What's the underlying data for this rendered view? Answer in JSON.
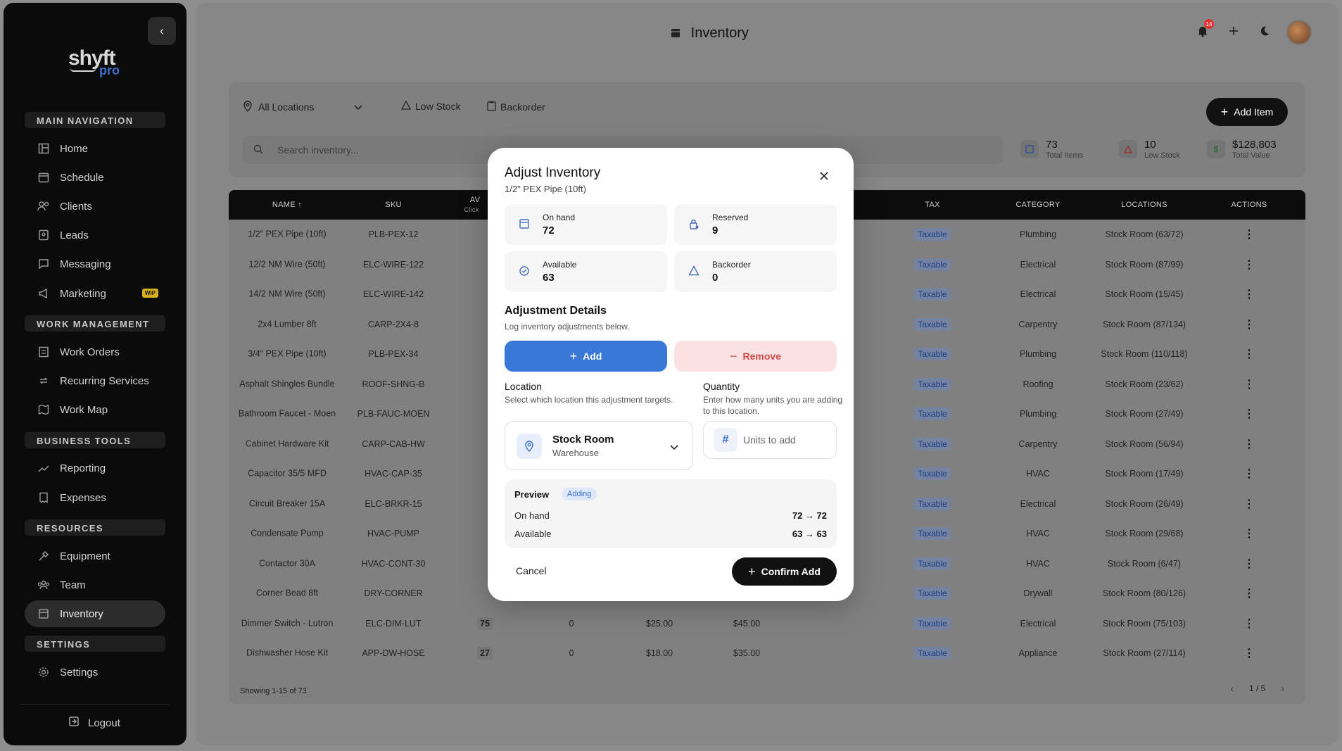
{
  "colors": {
    "accent": "#3a78d8",
    "danger": "#d04a4a",
    "dark": "#111111",
    "wip": "#d7b01c"
  },
  "sidebar": {
    "logo_text": "shyft",
    "logo_sub": "pro",
    "sections": {
      "main": "MAIN NAVIGATION",
      "work": "WORK MANAGEMENT",
      "business": "BUSINESS TOOLS",
      "resources": "RESOURCES",
      "settings": "SETTINGS"
    },
    "items": {
      "home": "Home",
      "schedule": "Schedule",
      "clients": "Clients",
      "leads": "Leads",
      "messaging": "Messaging",
      "marketing": "Marketing",
      "marketing_badge": "WIP",
      "work_orders": "Work Orders",
      "recurring": "Recurring Services",
      "work_map": "Work Map",
      "reporting": "Reporting",
      "expenses": "Expenses",
      "equipment": "Equipment",
      "team": "Team",
      "inventory": "Inventory",
      "settings": "Settings"
    },
    "logout": "Logout"
  },
  "header": {
    "title": "Inventory",
    "notification_count": "14"
  },
  "toolbar": {
    "location": "All Locations",
    "low_stock": "Low Stock",
    "backorder": "Backorder",
    "add_item": "Add Item",
    "search_placeholder": "Search inventory..."
  },
  "stats": {
    "total_items": {
      "value": "73",
      "label": "Total Items"
    },
    "low_stock": {
      "value": "10",
      "label": "Low Stock"
    },
    "total_value": {
      "value": "$128,803",
      "label": "Total Value"
    }
  },
  "table": {
    "headers": {
      "name": "NAME",
      "sku": "SKU",
      "avail": "AV",
      "avail_sub": "Click",
      "tax": "TAX",
      "category": "CATEGORY",
      "locations": "LOCATIONS",
      "actions": "ACTIONS"
    },
    "rows": [
      {
        "name": "1/2\" PEX Pipe (10ft)",
        "sku": "PLB-PEX-12",
        "tax": "Taxable",
        "category": "Plumbing",
        "location": "Stock Room (63/72)"
      },
      {
        "name": "12/2 NM Wire (50ft)",
        "sku": "ELC-WIRE-122",
        "tax": "Taxable",
        "category": "Electrical",
        "location": "Stock Room (87/99)"
      },
      {
        "name": "14/2 NM Wire (50ft)",
        "sku": "ELC-WIRE-142",
        "tax": "Taxable",
        "category": "Electrical",
        "location": "Stock Room (15/45)"
      },
      {
        "name": "2x4 Lumber 8ft",
        "sku": "CARP-2X4-8",
        "tax": "Taxable",
        "category": "Carpentry",
        "location": "Stock Room (87/134)"
      },
      {
        "name": "3/4\" PEX Pipe (10ft)",
        "sku": "PLB-PEX-34",
        "tax": "Taxable",
        "category": "Plumbing",
        "location": "Stock Room (110/118)"
      },
      {
        "name": "Asphalt Shingles Bundle",
        "sku": "ROOF-SHNG-B",
        "tax": "Taxable",
        "category": "Roofing",
        "location": "Stock Room (23/62)"
      },
      {
        "name": "Bathroom Faucet - Moen",
        "sku": "PLB-FAUC-MOEN",
        "tax": "Taxable",
        "category": "Plumbing",
        "location": "Stock Room (27/49)"
      },
      {
        "name": "Cabinet Hardware Kit",
        "sku": "CARP-CAB-HW",
        "tax": "Taxable",
        "category": "Carpentry",
        "location": "Stock Room (56/94)"
      },
      {
        "name": "Capacitor 35/5 MFD",
        "sku": "HVAC-CAP-35",
        "tax": "Taxable",
        "category": "HVAC",
        "location": "Stock Room (17/49)"
      },
      {
        "name": "Circuit Breaker 15A",
        "sku": "ELC-BRKR-15",
        "tax": "Taxable",
        "category": "Electrical",
        "location": "Stock Room (26/49)"
      },
      {
        "name": "Condensate Pump",
        "sku": "HVAC-PUMP",
        "tax": "Taxable",
        "category": "HVAC",
        "location": "Stock Room (29/68)"
      },
      {
        "name": "Contactor 30A",
        "sku": "HVAC-CONT-30",
        "tax": "Taxable",
        "category": "HVAC",
        "location": "Stock Room (6/47)"
      },
      {
        "name": "Corner Bead 8ft",
        "sku": "DRY-CORNER",
        "tax": "Taxable",
        "category": "Drywall",
        "location": "Stock Room (80/126)"
      },
      {
        "name": "Dimmer Switch - Lutron",
        "sku": "ELC-DIM-LUT",
        "avail": "75",
        "reserved": "0",
        "cost": "$25.00",
        "price": "$45.00",
        "tax": "Taxable",
        "category": "Electrical",
        "location": "Stock Room (75/103)"
      },
      {
        "name": "Dishwasher Hose Kit",
        "sku": "APP-DW-HOSE",
        "avail": "27",
        "reserved": "0",
        "cost": "$18.00",
        "price": "$35.00",
        "tax": "Taxable",
        "category": "Appliance",
        "location": "Stock Room (27/114)"
      }
    ],
    "footer": "Showing 1-15 of 73",
    "page": "1 / 5"
  },
  "modal": {
    "title": "Adjust Inventory",
    "subtitle": "1/2\" PEX Pipe (10ft)",
    "on_hand_label": "On hand",
    "on_hand": "72",
    "reserved_label": "Reserved",
    "reserved": "9",
    "available_label": "Available",
    "available": "63",
    "backorder_label": "Backorder",
    "backorder": "0",
    "section_title": "Adjustment Details",
    "section_sub": "Log inventory adjustments below.",
    "add_label": "Add",
    "remove_label": "Remove",
    "location_label": "Location",
    "location_help": "Select which location this adjustment targets.",
    "location_name": "Stock Room",
    "location_type": "Warehouse",
    "quantity_label": "Quantity",
    "quantity_help": "Enter how many units you are adding to this location.",
    "quantity_placeholder": "Units to add",
    "preview_title": "Preview",
    "preview_badge": "Adding",
    "preview_on_hand_label": "On hand",
    "preview_on_hand": "72 → 72",
    "preview_available_label": "Available",
    "preview_available": "63 → 63",
    "cancel": "Cancel",
    "confirm": "Confirm Add"
  }
}
